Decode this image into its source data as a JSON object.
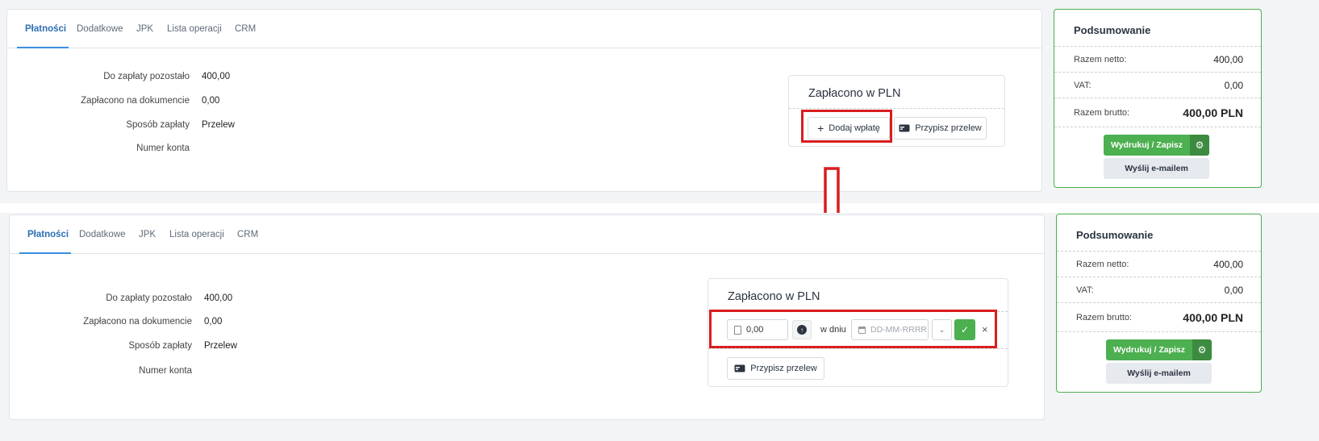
{
  "tabs": [
    "Płatności",
    "Dodatkowe",
    "JPK",
    "Lista operacji",
    "CRM"
  ],
  "details": {
    "remaining_label": "Do zapłaty pozostało",
    "remaining_value": "400,00",
    "paid_label": "Zapłacono na dokumencie",
    "paid_value": "0,00",
    "method_label": "Sposób zapłaty",
    "method_value": "Przelew",
    "account_label": "Numer konta"
  },
  "paid_box": {
    "title": "Zapłacono w PLN",
    "add_payment": "Dodaj wpłatę",
    "assign_transfer": "Przypisz przelew",
    "amount_value": "0,00",
    "date_prefix": "w dniu",
    "date_placeholder": "DD-MM-RRRR"
  },
  "summary": {
    "title": "Podsumowanie",
    "net_label": "Razem netto:",
    "net_value": "400,00",
    "vat_label": "VAT:",
    "vat_value": "0,00",
    "gross_label": "Razem brutto:",
    "gross_value": "400,00 PLN",
    "print_button": "Wydrukuj / Zapisz",
    "email_button": "Wyślij e-mailem"
  },
  "colors": {
    "accent_blue": "#3b8fe0",
    "success_green": "#4caf50",
    "highlight_red": "#d81e1e"
  },
  "icons": [
    "plus-icon",
    "transfer-icon",
    "calculator-icon",
    "arrow-up-icon",
    "calendar-icon",
    "chevron-down-icon",
    "check-icon",
    "close-icon",
    "gear-icon",
    "down-arrow-annotation"
  ]
}
